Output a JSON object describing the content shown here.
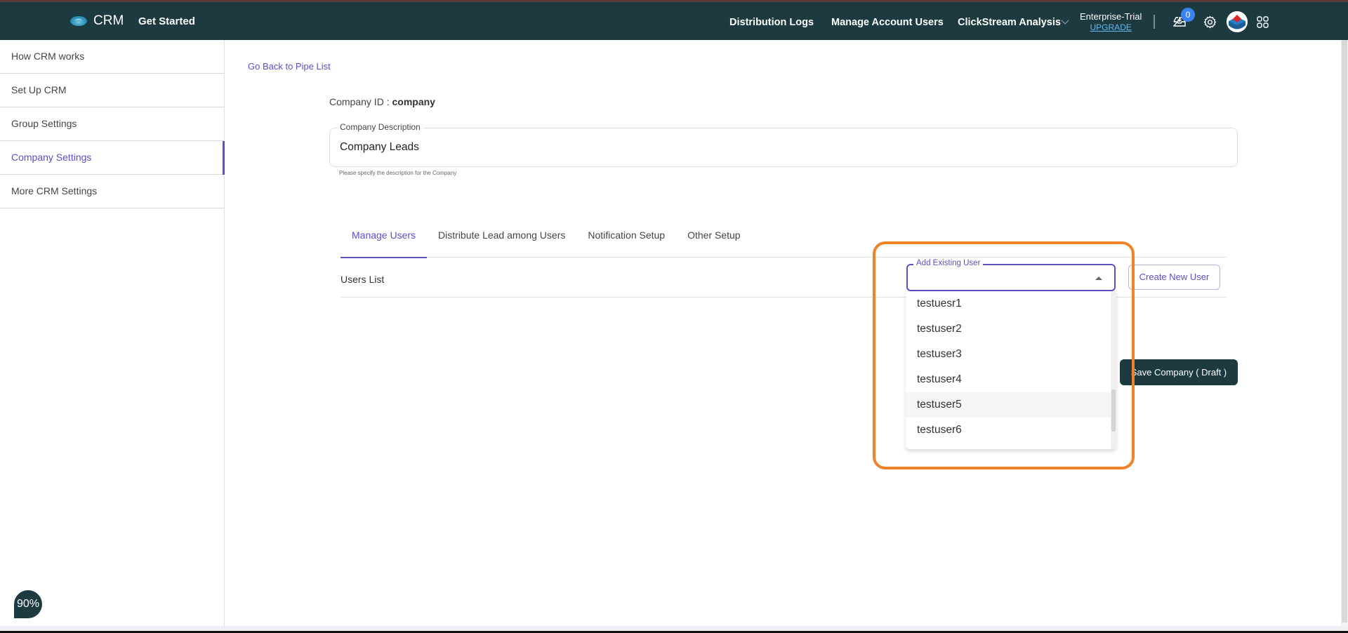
{
  "header": {
    "app_name": "CRM",
    "get_started": "Get Started",
    "nav": {
      "distribution_logs": "Distribution Logs",
      "manage_account_users": "Manage Account Users",
      "clickstream_analysis": "ClickStream Analysis"
    },
    "plan": {
      "name": "Enterprise-Trial",
      "upgrade": "UPGRADE"
    },
    "notification_count": "0"
  },
  "sidebar": {
    "items": [
      {
        "label": "How CRM works"
      },
      {
        "label": "Set Up CRM"
      },
      {
        "label": "Group Settings"
      },
      {
        "label": "Company Settings",
        "active": true
      },
      {
        "label": "More CRM Settings"
      }
    ]
  },
  "zoom_level": "90%",
  "main": {
    "back_link": "Go Back to Pipe List",
    "company_id_label": "Company ID : ",
    "company_id_value": "company",
    "description": {
      "label": "Company Description",
      "value": "Company Leads",
      "help": "Please specify the description for the Company"
    },
    "tabs": [
      {
        "label": "Manage Users",
        "active": true
      },
      {
        "label": "Distribute Lead among Users"
      },
      {
        "label": "Notification Setup"
      },
      {
        "label": "Other Setup"
      }
    ],
    "users_list_title": "Users List",
    "add_existing_user": {
      "label": "Add Existing User",
      "value": "",
      "options": [
        "testuesr1",
        "testuser2",
        "testuser3",
        "testuser4",
        "testuser5",
        "testuser6"
      ],
      "hovered": "testuser5"
    },
    "create_new_user": "Create New User",
    "save_company": "Save Company ( Draft )"
  },
  "colors": {
    "header_bg": "#1c3a40",
    "accent": "#5b4fc4",
    "highlight": "#f08228",
    "badge": "#3b82f6"
  }
}
